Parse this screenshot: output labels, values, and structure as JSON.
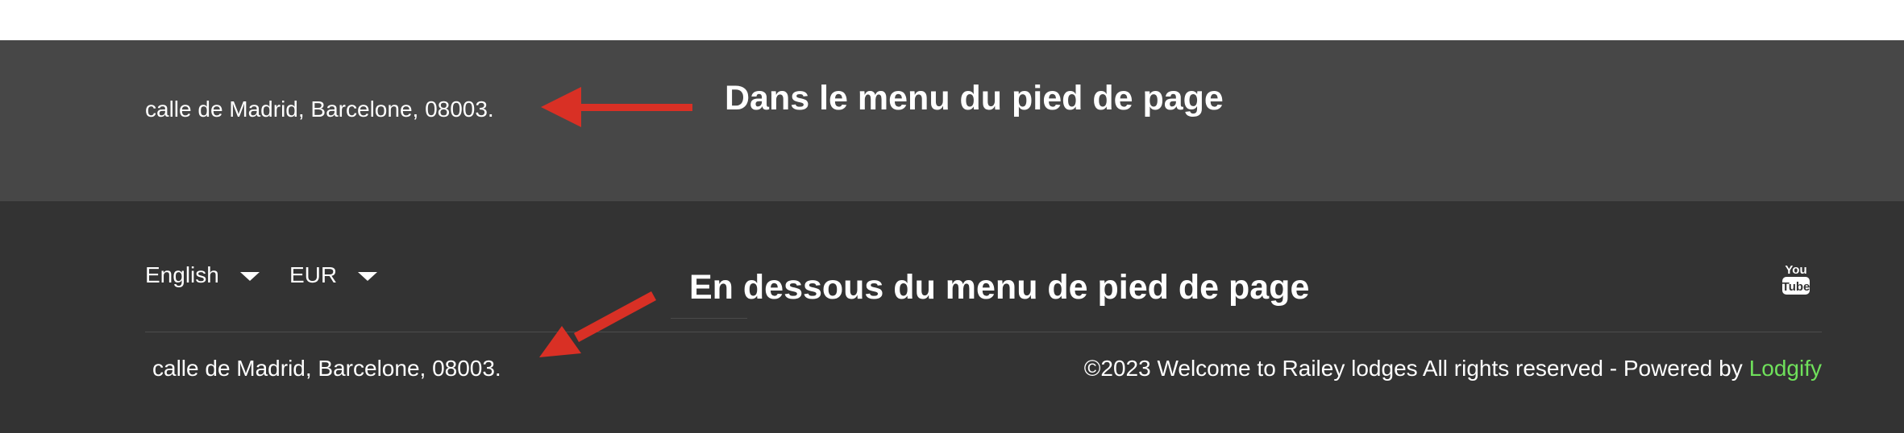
{
  "footer_upper": {
    "address": "calle de Madrid, Barcelone, 08003."
  },
  "footer_lower": {
    "language_selector": {
      "value": "English"
    },
    "currency_selector": {
      "value": "EUR"
    },
    "social": {
      "icon": "youtube-icon",
      "label": "You Tube"
    },
    "address": "calle de Madrid, Barcelone, 08003.",
    "copyright_text": "©2023 Welcome to Railey lodges All rights reserved - Powered by",
    "powered_by_link": "Lodgify"
  },
  "annotations": {
    "upper_label": "Dans le menu du pied de page",
    "lower_label": "En dessous du menu de pied de page"
  },
  "colors": {
    "footer_upper_bg": "#474747",
    "footer_lower_bg": "#333333",
    "text": "#ffffff",
    "link": "#6fe05b",
    "annotation_arrow": "#d93025"
  }
}
